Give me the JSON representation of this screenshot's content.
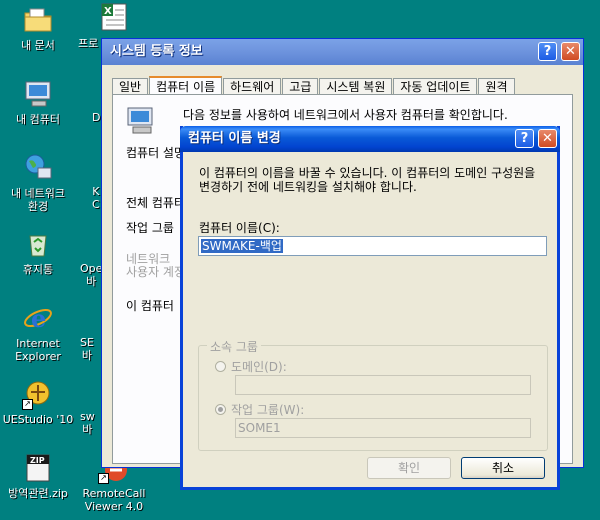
{
  "desktop": {
    "icons": [
      {
        "name": "my-documents",
        "label": "내 문서",
        "icon": "folder-icon"
      },
      {
        "name": "my-computer",
        "label": "내 컴퓨터",
        "icon": "computer-icon"
      },
      {
        "name": "my-network",
        "label": "내 네트워크\n환경",
        "icon": "network-icon"
      },
      {
        "name": "recycle-bin",
        "label": "휴지통",
        "icon": "recycle-bin-icon"
      },
      {
        "name": "internet-explorer",
        "label": "Internet\nExplorer",
        "icon": "ie-icon"
      },
      {
        "name": "uestudio",
        "label": "UEStudio '10",
        "icon": "uestudio-icon"
      },
      {
        "name": "zip-file",
        "label": "방역관련.zip",
        "icon": "zip-icon"
      },
      {
        "name": "remotecall",
        "label": "RemoteCall\nViewer 4.0",
        "icon": "remotecall-icon"
      }
    ],
    "partials": {
      "p1": "프로",
      "p2": "D",
      "p3": "K\nC",
      "p4": "Ope\n바",
      "p5": "SE\n바",
      "p6": "sw\n바"
    }
  },
  "system_properties": {
    "title": "시스템 등록 정보",
    "tabs": [
      "일반",
      "컴퓨터 이름",
      "하드웨어",
      "고급",
      "시스템 복원",
      "자동 업데이트",
      "원격"
    ],
    "active_tab": "컴퓨터 이름",
    "intro": "다음 정보를 사용하여 네트워크에서 사용자 컴퓨터를 확인합니다.",
    "desc_label": "컴퓨터 설명",
    "full_name_label": "전체 컴퓨터",
    "workgroup_label": "작업 그룹",
    "network_line1": "네트워크",
    "network_line2": "사용자 계정",
    "rename_label": "이 컴퓨터"
  },
  "rename_dialog": {
    "title": "컴퓨터 이름 변경",
    "description": "이 컴퓨터의 이름을 바꿀 수 있습니다. 이 컴퓨터의 도메인 구성원을 변경하기 전에 네트워킹을 설치해야 합니다.",
    "name_label": "컴퓨터 이름(C):",
    "name_value": "SWMAKE-백업",
    "group_title": "소속 그룹",
    "domain_label": "도메인(D):",
    "domain_value": "",
    "workgroup_label": "작업 그룹(W):",
    "workgroup_value": "SOME1",
    "selected_membership": "workgroup",
    "ok_label": "확인",
    "cancel_label": "취소"
  }
}
